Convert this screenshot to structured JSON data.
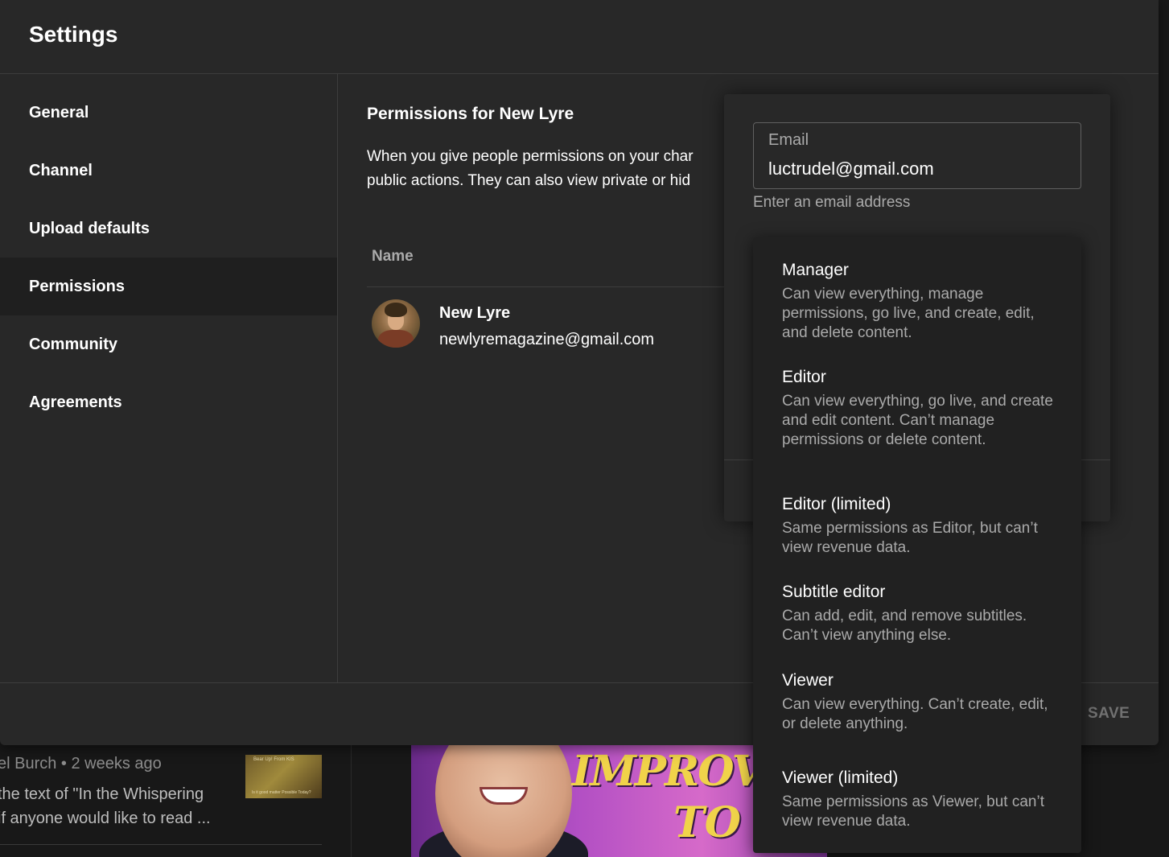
{
  "background": {
    "comment_meta": "el Burch • 2 weeks ago",
    "comment_line1": "the text of \"In the Whispering",
    "comment_line2": "if anyone would like to read ...",
    "thumb_caption_top": "Bear Up! From KIS",
    "thumb_caption_bottom": "Is it good matter Possible Today?",
    "video_text_line1": "IMPROVEMEN",
    "video_text_line2": "TO"
  },
  "modal": {
    "title": "Settings",
    "save_label": "SAVE"
  },
  "sidebar": {
    "items": [
      {
        "label": "General"
      },
      {
        "label": "Channel"
      },
      {
        "label": "Upload defaults"
      },
      {
        "label": "Permissions"
      },
      {
        "label": "Community"
      },
      {
        "label": "Agreements"
      }
    ],
    "active": "Permissions"
  },
  "permissions": {
    "title": "Permissions for New Lyre",
    "description_line1": "When you give people permissions on your char",
    "description_line2": "public actions. They can also view private or hid",
    "column_name": "Name",
    "users": [
      {
        "name": "New Lyre",
        "email": "newlyremagazine@gmail.com"
      }
    ]
  },
  "invite": {
    "email_label": "Email",
    "email_value": "luctrudel@gmail.com",
    "email_helper": "Enter an email address"
  },
  "roles": [
    {
      "title": "Manager",
      "desc": "Can view everything, manage permissions, go live, and create, edit, and delete content."
    },
    {
      "title": "Editor",
      "desc": "Can view everything, go live, and create and edit content. Can’t manage permissions or delete content."
    },
    {
      "title": "Editor (limited)",
      "desc": "Same permissions as Editor, but can’t view revenue data."
    },
    {
      "title": "Subtitle editor",
      "desc": "Can add, edit, and remove subtitles. Can’t view anything else."
    },
    {
      "title": "Viewer",
      "desc": "Can view everything. Can’t create, edit, or delete anything."
    },
    {
      "title": "Viewer (limited)",
      "desc": "Same permissions as Viewer, but can’t view revenue data."
    }
  ]
}
